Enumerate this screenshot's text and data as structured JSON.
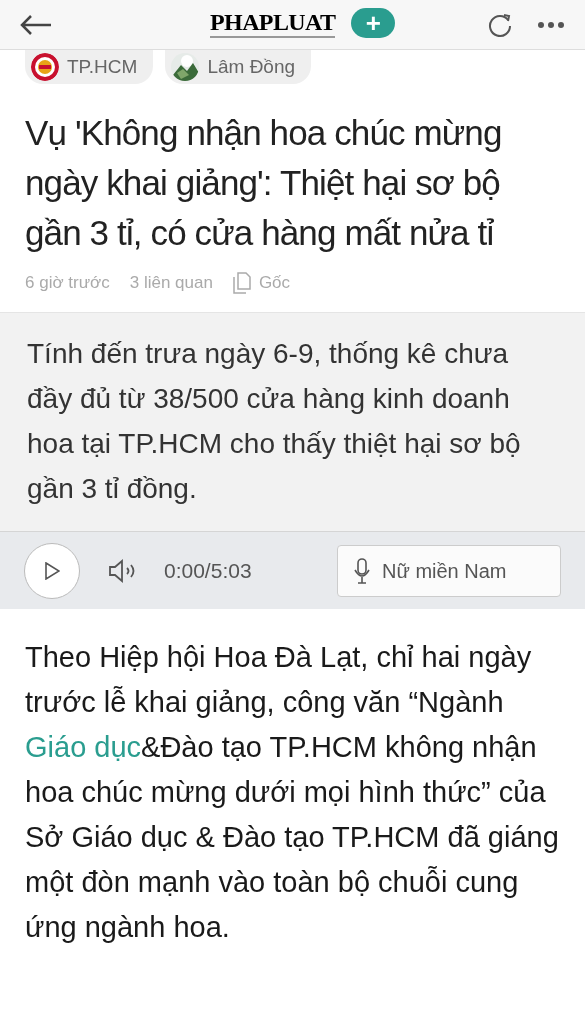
{
  "header": {
    "logo": "PHAPLUAT",
    "follow_button": "+"
  },
  "tags": [
    {
      "label": "TP.HCM"
    },
    {
      "label": "Lâm Đồng"
    }
  ],
  "title": "Vụ 'Không nhận hoa chúc mừng ngày khai giảng': Thiệt hại sơ bộ gần 3 tỉ, có cửa hàng mất nửa tỉ",
  "meta": {
    "time": "6 giờ trước",
    "related": "3 liên quan",
    "source": "Gốc"
  },
  "summary": "Tính đến trưa ngày 6-9, thống kê chưa đầy đủ từ 38/500 cửa hàng kinh doanh hoa tại TP.HCM cho thấy thiệt hại sơ bộ gần 3 tỉ đồng.",
  "audio": {
    "time": "0:00/5:03",
    "voice": "Nữ miền Nam"
  },
  "body": {
    "before": "Theo Hiệp hội Hoa Đà Lạt, chỉ hai ngày trước lễ khai giảng, công văn “Ngành ",
    "link": "Giáo dục",
    "after": "&Đào tạo TP.HCM không nhận hoa chúc mừng dưới mọi hình thức” của Sở Giáo dục & Đào tạo TP.HCM đã giáng một đòn mạnh vào toàn bộ chuỗi cung ứng ngành hoa."
  }
}
